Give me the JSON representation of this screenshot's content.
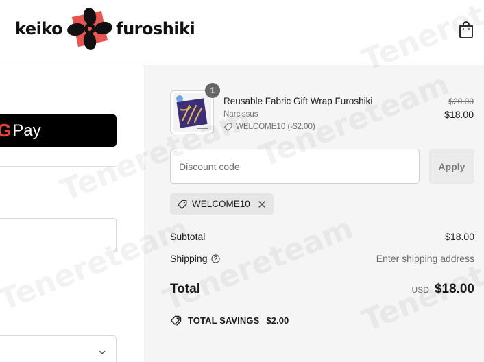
{
  "header": {
    "brand_left": "keiko",
    "brand_right": "furoshiki",
    "cart_icon": "shopping-bag-icon"
  },
  "express_checkout": {
    "gpay_g": "G",
    "gpay_label": "Pay"
  },
  "order_summary": {
    "item": {
      "quantity": "1",
      "name": "Reusable Fabric Gift Wrap Furoshiki",
      "variant": "Narcissus",
      "discount_note": "WELCOME10 (-$2.00)",
      "original_price": "$20.00",
      "price": "$18.00"
    },
    "discount": {
      "placeholder": "Discount code",
      "apply_label": "Apply",
      "applied_code": "WELCOME10"
    },
    "subtotal_label": "Subtotal",
    "subtotal_value": "$18.00",
    "shipping_label": "Shipping",
    "shipping_value": "Enter shipping address",
    "total_label": "Total",
    "total_currency": "USD",
    "total_value": "$18.00",
    "savings_label": "TOTAL SAVINGS",
    "savings_value": "$2.00"
  },
  "watermark": "Tenereteam",
  "colors": {
    "brand_red": "#e8554e",
    "summary_bg": "#f5f5f5",
    "apply_bg": "#ebebeb",
    "gpay_bg": "#000000"
  }
}
